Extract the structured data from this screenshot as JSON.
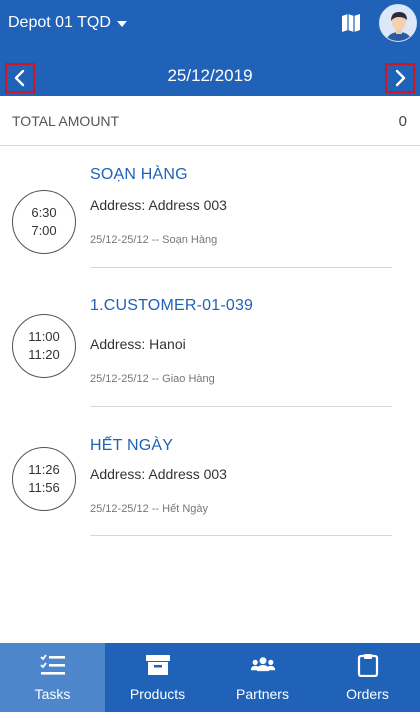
{
  "header": {
    "depot_label": "Depot 01 TQD",
    "date": "25/12/2019"
  },
  "summary": {
    "total_label": "TOTAL AMOUNT",
    "total_value": "0"
  },
  "tasks": [
    {
      "start": "6:30",
      "end": "7:00",
      "title": "SOẠN HÀNG",
      "address": "Address: Address 003",
      "meta": "25/12-25/12 -- Soạn Hàng"
    },
    {
      "start": "11:00",
      "end": "11:20",
      "title": "1.CUSTOMER-01-039",
      "address": "Address: Hanoi",
      "meta": "25/12-25/12 -- Giao Hàng"
    },
    {
      "start": "11:26",
      "end": "11:56",
      "title": "HẾT NGÀY",
      "address": "Address: Address 003",
      "meta": "25/12-25/12 -- Hết Ngày"
    }
  ],
  "tabs": [
    {
      "label": "Tasks",
      "icon": "tasks-icon",
      "active": true
    },
    {
      "label": "Products",
      "icon": "box-icon",
      "active": false
    },
    {
      "label": "Partners",
      "icon": "people-icon",
      "active": false
    },
    {
      "label": "Orders",
      "icon": "clipboard-icon",
      "active": false
    }
  ],
  "colors": {
    "primary": "#1f62b8",
    "active_tab": "#4e86cc",
    "highlight_border": "#d0161d"
  }
}
